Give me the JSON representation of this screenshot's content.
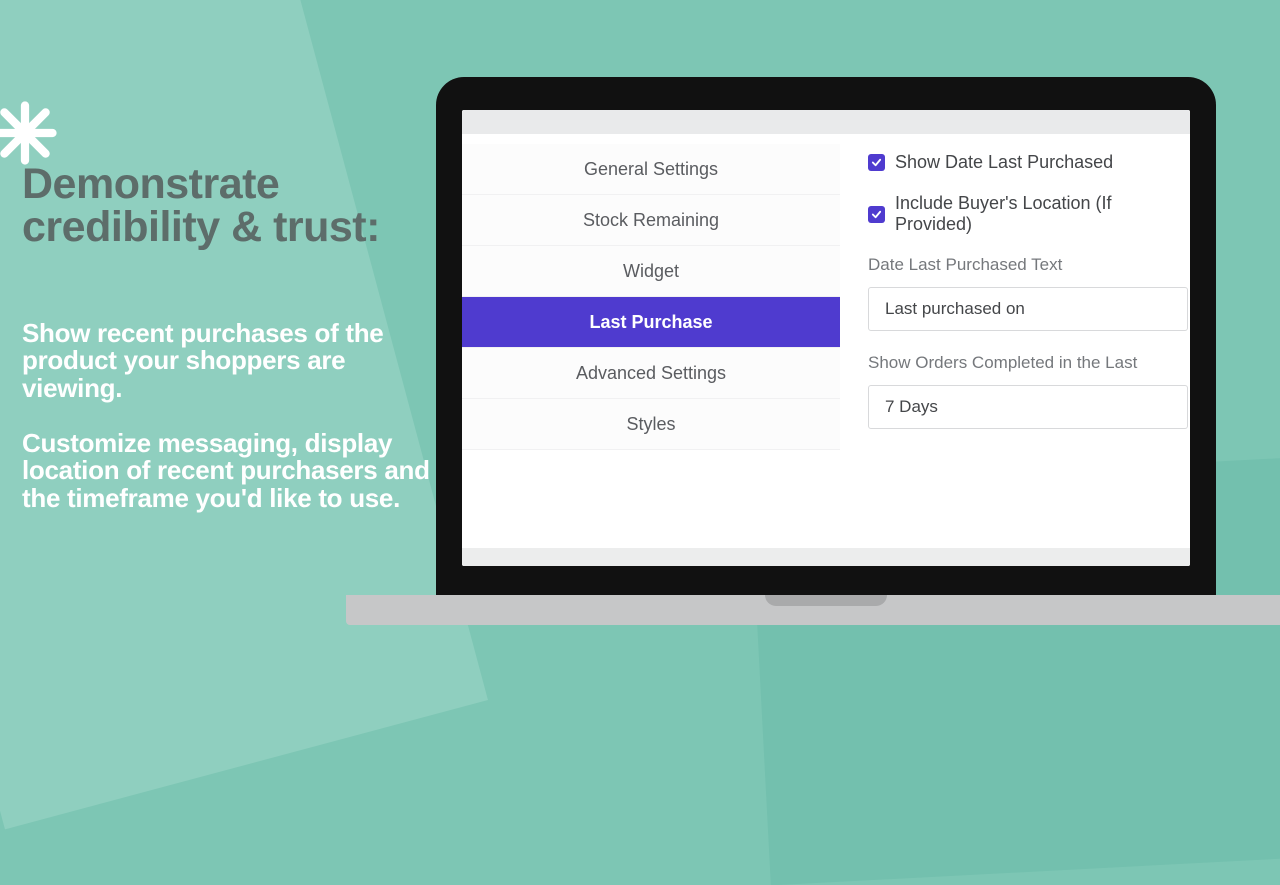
{
  "heading": "Demonstrate credibility & trust:",
  "para1": "Show recent purchases of the product your shoppers are viewing.",
  "para2": "Customize messaging, display location of recent purchasers and the timeframe you'd like to use.",
  "menu": {
    "items": [
      {
        "label": "General Settings"
      },
      {
        "label": "Stock Remaining"
      },
      {
        "label": "Widget"
      },
      {
        "label": "Last Purchase"
      },
      {
        "label": "Advanced Settings"
      },
      {
        "label": "Styles"
      }
    ],
    "active_index": 3
  },
  "panel": {
    "chk_show_date_label": "Show Date Last Purchased",
    "chk_include_loc_label": "Include Buyer's Location (If Provided)",
    "date_text_label": "Date Last Purchased Text",
    "date_text_value": "Last purchased on",
    "orders_window_label": "Show Orders Completed in the Last",
    "orders_window_value": "7 Days"
  },
  "colors": {
    "accent": "#4f3bcf",
    "bg": "#7dc6b4"
  }
}
